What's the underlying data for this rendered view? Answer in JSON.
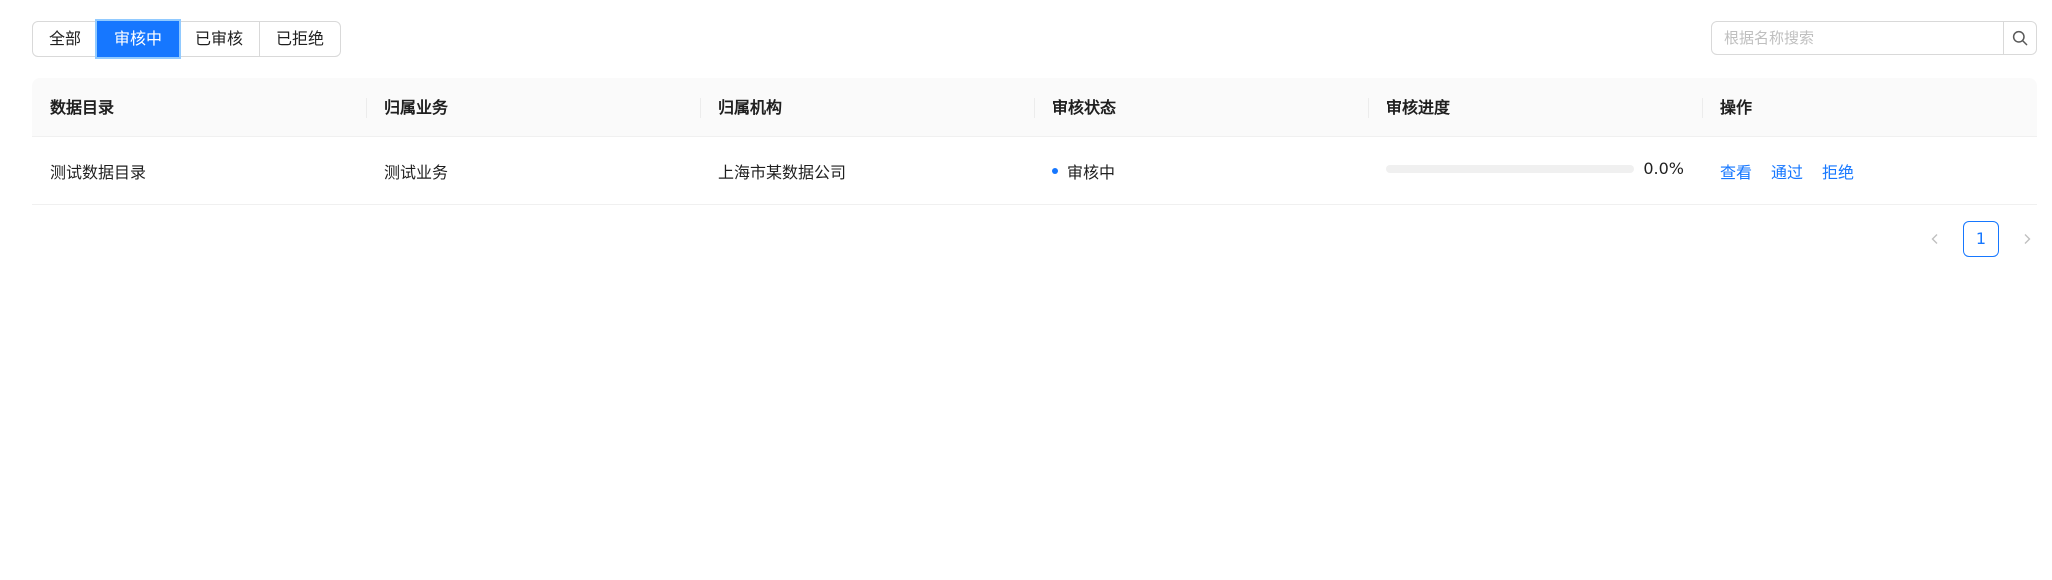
{
  "filters": {
    "tabs": [
      {
        "label": "全部",
        "active": false
      },
      {
        "label": "审核中",
        "active": true
      },
      {
        "label": "已审核",
        "active": false
      },
      {
        "label": "已拒绝",
        "active": false
      }
    ]
  },
  "search": {
    "placeholder": "根据名称搜索",
    "value": "",
    "icon": "search-icon"
  },
  "table": {
    "columns": [
      "数据目录",
      "归属业务",
      "归属机构",
      "审核状态",
      "审核进度",
      "操作"
    ],
    "rows": [
      {
        "catalog": "测试数据目录",
        "business": "测试业务",
        "org": "上海市某数据公司",
        "status": "审核中",
        "status_color": "#1677ff",
        "progress": 0.0,
        "progress_label": "0.0%",
        "actions": [
          "查看",
          "通过",
          "拒绝"
        ]
      }
    ]
  },
  "pagination": {
    "current": "1",
    "prev_icon": "chevron-left-icon",
    "next_icon": "chevron-right-icon"
  },
  "colors": {
    "accent": "#1677ff"
  }
}
